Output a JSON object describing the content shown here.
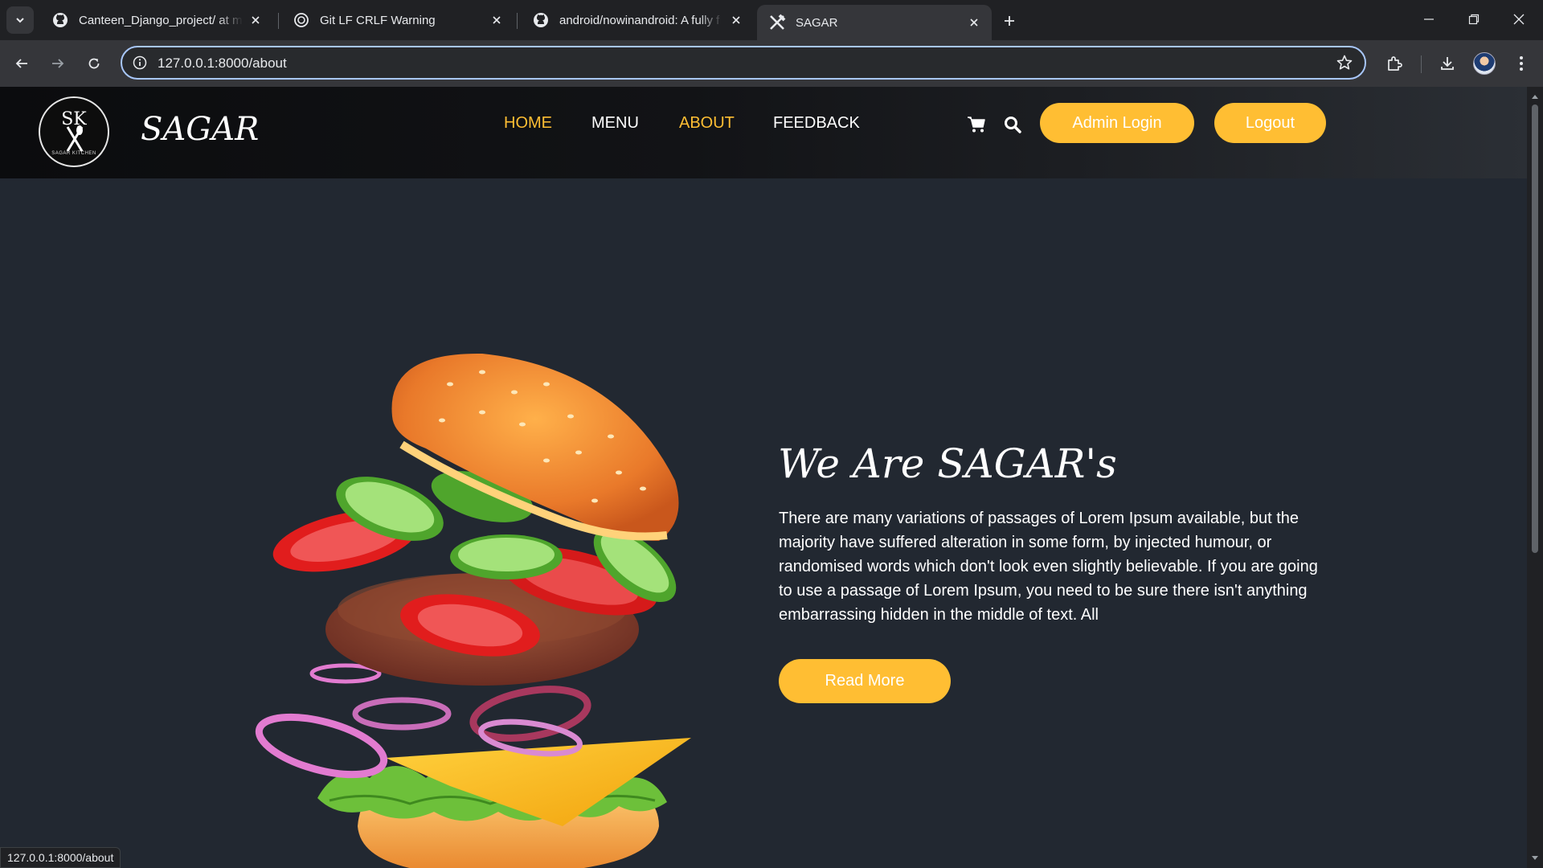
{
  "browser": {
    "tabs": [
      {
        "title": "Canteen_Django_project/ at ma",
        "favicon": "github-icon",
        "active": false
      },
      {
        "title": "Git LF CRLF Warning",
        "favicon": "chatgpt-icon",
        "active": false
      },
      {
        "title": "android/nowinandroid: A fully f",
        "favicon": "github-icon",
        "active": false
      },
      {
        "title": "SAGAR",
        "favicon": "crossed-utensils-icon",
        "active": true
      }
    ],
    "url": "127.0.0.1:8000/about",
    "status_url": "127.0.0.1:8000/about"
  },
  "site": {
    "logo_text": "SK",
    "logo_subtext": "SAGAR KITCHEN",
    "brand": "SAGAR",
    "nav": [
      {
        "label": "HOME",
        "active": true
      },
      {
        "label": "MENU",
        "active": false
      },
      {
        "label": "ABOUT",
        "active": true
      },
      {
        "label": "FEEDBACK",
        "active": false
      }
    ],
    "admin_login": "Admin Login",
    "logout": "Logout",
    "accent_color": "#ffbe33",
    "background_color": "#222831"
  },
  "about": {
    "title": "We Are SAGAR's",
    "text": "There are many variations of passages of Lorem Ipsum available, but the majority have suffered alteration in some form, by injected humour, or randomised words which don't look even slightly believable. If you are going to use a passage of Lorem Ipsum, you need to be sure there isn't anything embarrassing hidden in the middle of text. All",
    "button": "Read More"
  }
}
